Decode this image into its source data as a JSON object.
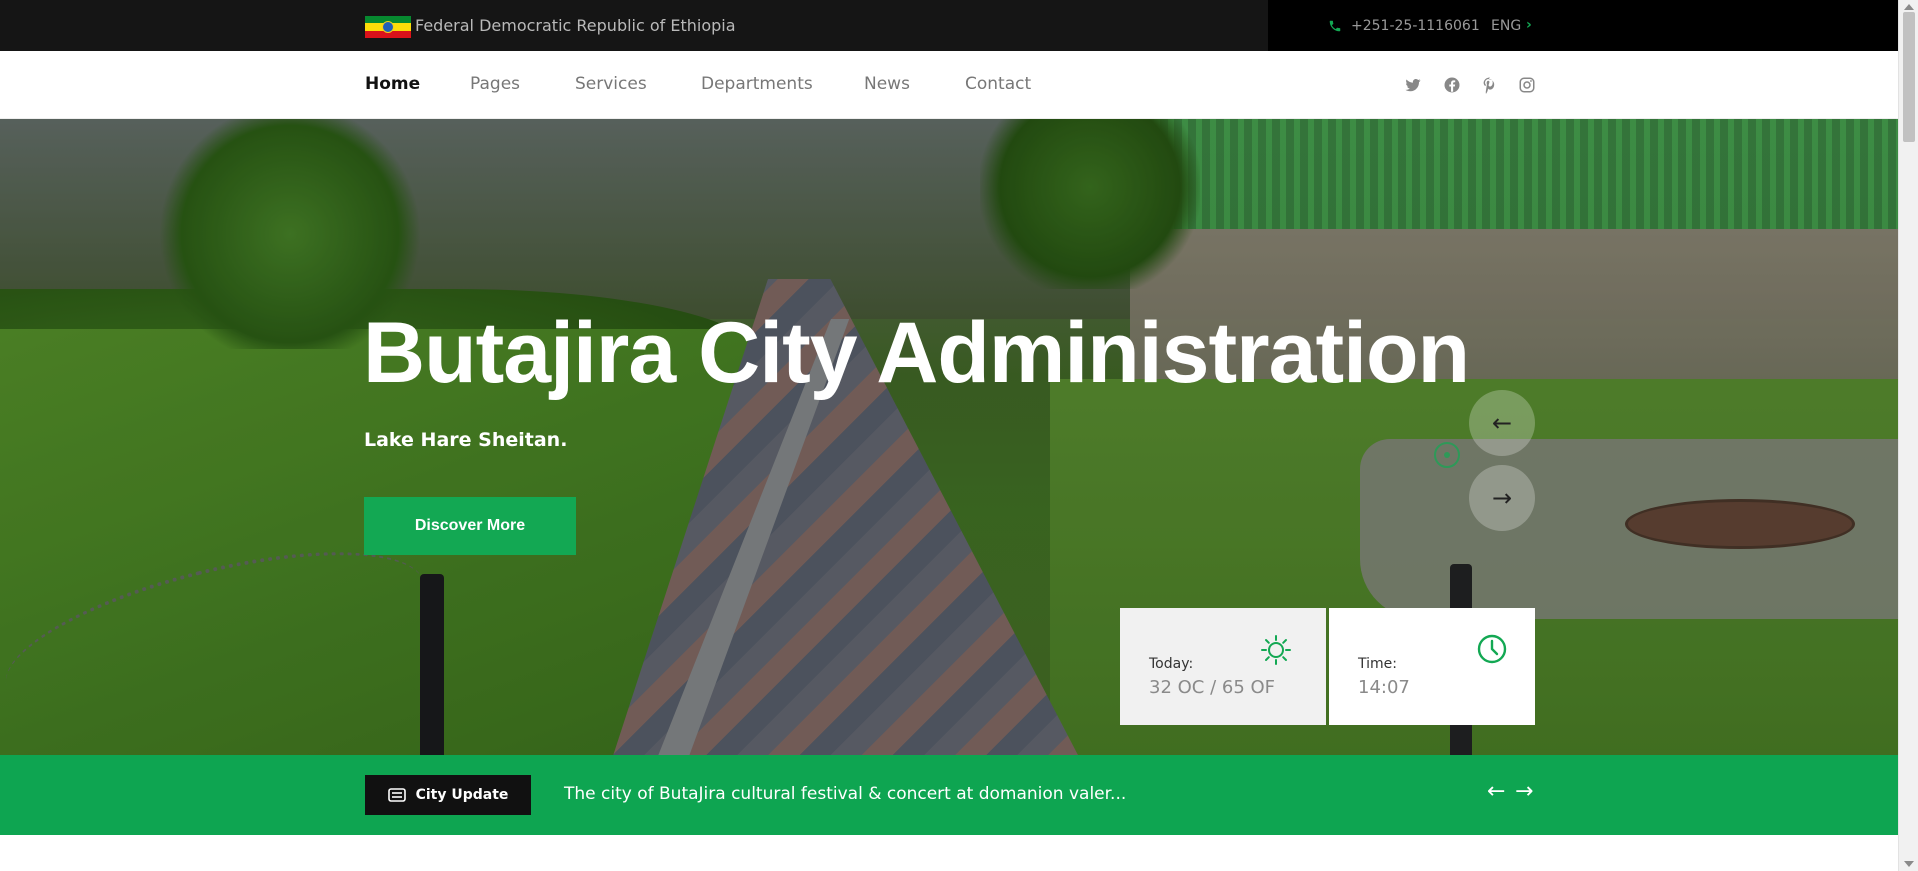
{
  "topbar": {
    "country": "Federal Democratic Republic of Ethiopia",
    "phone": "+251-25-1116061",
    "language": "ENG",
    "flag_colors": [
      "#078930",
      "#fcdd09",
      "#da121a"
    ],
    "icons": {
      "phone": "phone-icon",
      "language_arrow": "chevron-right-icon"
    }
  },
  "nav": {
    "items": [
      {
        "label": "Home",
        "active": true
      },
      {
        "label": "Pages",
        "active": false
      },
      {
        "label": "Services",
        "active": false
      },
      {
        "label": "Departments",
        "active": false
      },
      {
        "label": "News",
        "active": false
      },
      {
        "label": "Contact",
        "active": false
      }
    ],
    "social": [
      "twitter-icon",
      "facebook-icon",
      "pinterest-icon",
      "instagram-icon"
    ]
  },
  "hero": {
    "title": "Butajira City Administration",
    "subtitle": "Lake Hare Sheitan.",
    "cta": "Discover More",
    "prev_arrow": "←",
    "next_arrow": "→"
  },
  "weather": {
    "label": "Today:",
    "value": "32 OC / 65 OF",
    "icon": "sun-icon"
  },
  "time": {
    "label": "Time:",
    "value": "14:07",
    "icon": "clock-icon"
  },
  "update": {
    "badge": "City Update",
    "text": "The city of ButaJira cultural festival & concert at domanion valer...",
    "prev": "←",
    "next": "→",
    "icon": "news-icon"
  },
  "colors": {
    "accent": "#13a853",
    "topbar": "#151515",
    "badge": "#111111"
  }
}
